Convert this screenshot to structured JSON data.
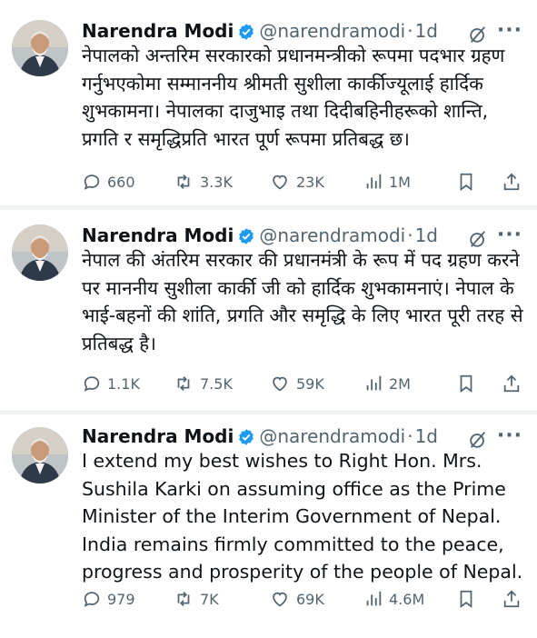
{
  "tweets": [
    {
      "author_name": "Narendra Modi",
      "handle": "@narendramodi",
      "separator": "·",
      "age": "1d",
      "more": "···",
      "text": "नेपालको अन्तरिम सरकारको प्रधानमन्त्रीको रूपमा पदभार ग्रहण गर्नुभएकोमा सम्माननीय श्रीमती सुशीला कार्कीज्यूलाई हार्दिक शुभकामना। नेपालका दाजुभाइ तथा दिदीबहिनीहरूको शान्ति, प्रगति र समृद्धिप्रति भारत पूर्ण रूपमा प्रतिबद्ध छ।",
      "replies": "660",
      "reposts": "3.3K",
      "likes": "23K",
      "views": "1M"
    },
    {
      "author_name": "Narendra Modi",
      "handle": "@narendramodi",
      "separator": "·",
      "age": "1d",
      "more": "···",
      "text": "नेपाल की अंतरिम सरकार की प्रधानमंत्री के रूप में पद ग्रहण करने पर माननीय सुशीला कार्की जी को हार्दिक शुभकामनाएं। नेपाल के भाई-बहनों की शांति, प्रगति और समृद्धि के लिए भारत पूरी तरह से प्रतिबद्ध है।",
      "replies": "1.1K",
      "reposts": "7.5K",
      "likes": "59K",
      "views": "2M"
    },
    {
      "author_name": "Narendra Modi",
      "handle": "@narendramodi",
      "separator": "·",
      "age": "1d",
      "more": "···",
      "text": "I extend my best wishes to Right Hon. Mrs. Sushila Karki on assuming office as the Prime Minister of the Interim Government of Nepal. India remains firmly committed to the peace, progress and prosperity of the people of Nepal.",
      "replies": "979",
      "reposts": "7K",
      "likes": "69K",
      "views": "4.6M"
    }
  ],
  "icons": {
    "verified": "verified-badge-icon",
    "grok": "grok-icon",
    "reply": "reply-icon",
    "repost": "repost-icon",
    "like": "like-icon",
    "views": "views-icon",
    "bookmark": "bookmark-icon",
    "share": "share-icon"
  },
  "colors": {
    "text": "#0f1419",
    "secondary": "#536471",
    "verified": "#1d9bf0",
    "divider": "#eff3f4"
  }
}
